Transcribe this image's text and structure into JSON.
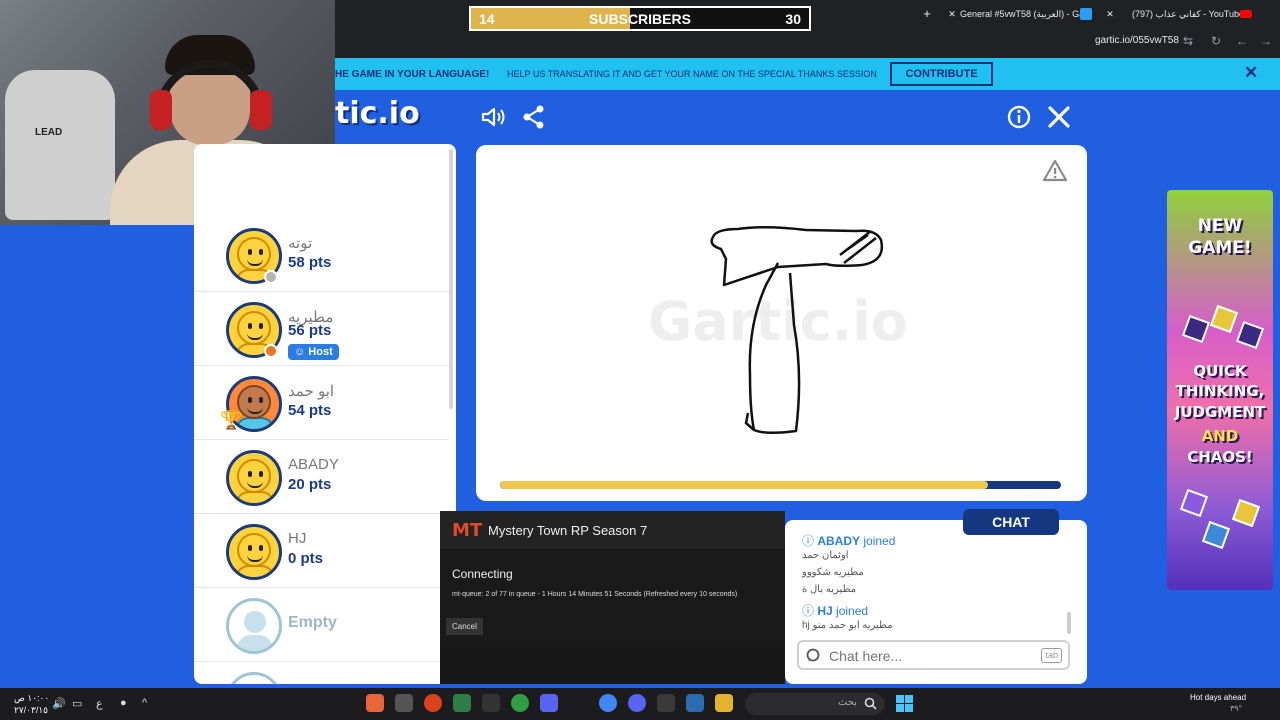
{
  "browser": {
    "tabs": [
      {
        "label": "General #5vwT58 (العربية) - Gar",
        "close": "✕"
      },
      {
        "label": "(797) كفاني عذاب - YouTube",
        "close": "✕"
      }
    ],
    "new_tab": "+",
    "url": "gartic.io/055vwT58"
  },
  "subscriber_goal": {
    "current": "14",
    "label": "SUBSCRIBERS",
    "goal": "30",
    "progress": 0.47
  },
  "webcam": {
    "chair_brand": "LEAD"
  },
  "banner": {
    "text_bold": "HE GAME IN YOUR LANGUAGE!",
    "text": "HELP US TRANSLATING IT AND GET YOUR NAME ON THE SPECIAL THANKS SESSION",
    "contribute": "CONTRIBUTE",
    "close": "✕"
  },
  "game": {
    "logo": "tic.io",
    "buttons": [
      "volume-icon",
      "share-icon",
      "info-icon",
      "close-icon"
    ]
  },
  "players": [
    {
      "name": "توته",
      "pts": "58 pts",
      "avatar": "yellow",
      "status": "gray"
    },
    {
      "name": "مطيريه",
      "pts": "56 pts",
      "avatar": "yellow",
      "status": "orange",
      "badge": "Host"
    },
    {
      "name": "ابو حمد",
      "pts": "54 pts",
      "avatar": "dark",
      "rank": "1"
    },
    {
      "name": "ABADY",
      "pts": "20 pts",
      "avatar": "yellow"
    },
    {
      "name": "HJ",
      "pts": "0 pts",
      "avatar": "yellow"
    },
    {
      "name": "Empty",
      "avatar": "empty"
    }
  ],
  "board": {
    "watermark": "Gartic.io",
    "timer_progress": 0.87
  },
  "chat": {
    "tab_label": "CHAT",
    "messages": [
      {
        "type": "join",
        "user": "ABADY",
        "text": "joined"
      },
      {
        "type": "msg",
        "text": "اوثمان حمد"
      },
      {
        "type": "msg",
        "text": "مطيريه شكووو"
      },
      {
        "type": "msg",
        "text": "مطيريه بال ة"
      },
      {
        "type": "join",
        "user": "HJ",
        "text": "joined"
      },
      {
        "type": "msg",
        "text": "hj مطيريه ابو حمد منو"
      }
    ],
    "placeholder": "Chat here...",
    "tab_key": "tab"
  },
  "overlay": {
    "logo": "MT",
    "title": "Mystery Town RP Season 7",
    "status": "Connecting",
    "queue": "mt-queue: 2 of 77 in queue - 1 Hours 14 Minutes 51 Seconds (Refreshed every 10 seconds)",
    "cancel": "Cancel"
  },
  "ad": {
    "line1": "NEW",
    "line2": "GAME!",
    "line3": "QUICK",
    "line4": "THINKING,",
    "line5": "JUDGMENT",
    "line6": "AND",
    "line7": "CHAOS!"
  },
  "taskbar": {
    "time": "١٠:٠٠ ص",
    "date": "٢٧/٠٣/١٥",
    "lang": "ع",
    "search_placeholder": "بحث",
    "weather_line1": "Hot days ahead",
    "weather_line2": "٣٩°"
  },
  "colors": {
    "page_bg": "#1f5fe0",
    "accent_dark": "#14377f",
    "banner": "#20c1f0",
    "timer_fill": "#f0c94c"
  }
}
